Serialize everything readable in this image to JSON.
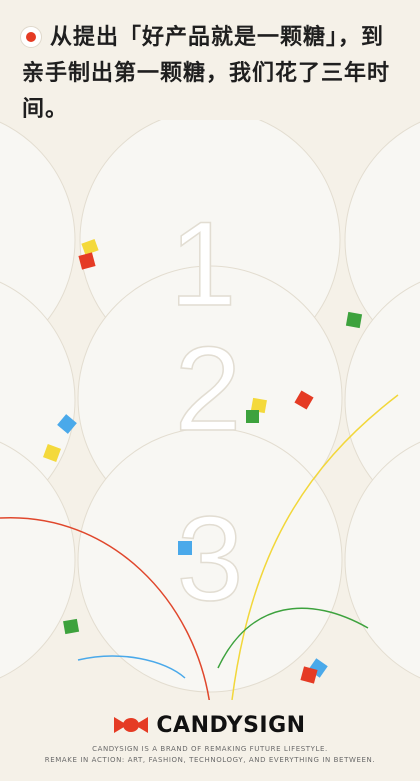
{
  "headline": {
    "text": "从提出「好产品就是一颗糖」，到亲手制出第一颗糖，我们花了三年时间。",
    "bullet_color": "#e53b24"
  },
  "art": {
    "numerals": [
      "1",
      "2",
      "3"
    ],
    "confetti_colors": [
      "#f4d93b",
      "#e53b24",
      "#4aa9ea",
      "#3da23d"
    ]
  },
  "footer": {
    "brand_name": "CANDYSIGN",
    "logo_icon": "candy-icon",
    "tagline_line1": "CANDYSIGN IS A BRAND OF REMAKING FUTURE LIFESTYLE.",
    "tagline_line2": "REMAKE IN ACTION: ART, FASHION, TECHNOLOGY, AND EVERYTHING IN BETWEEN."
  }
}
